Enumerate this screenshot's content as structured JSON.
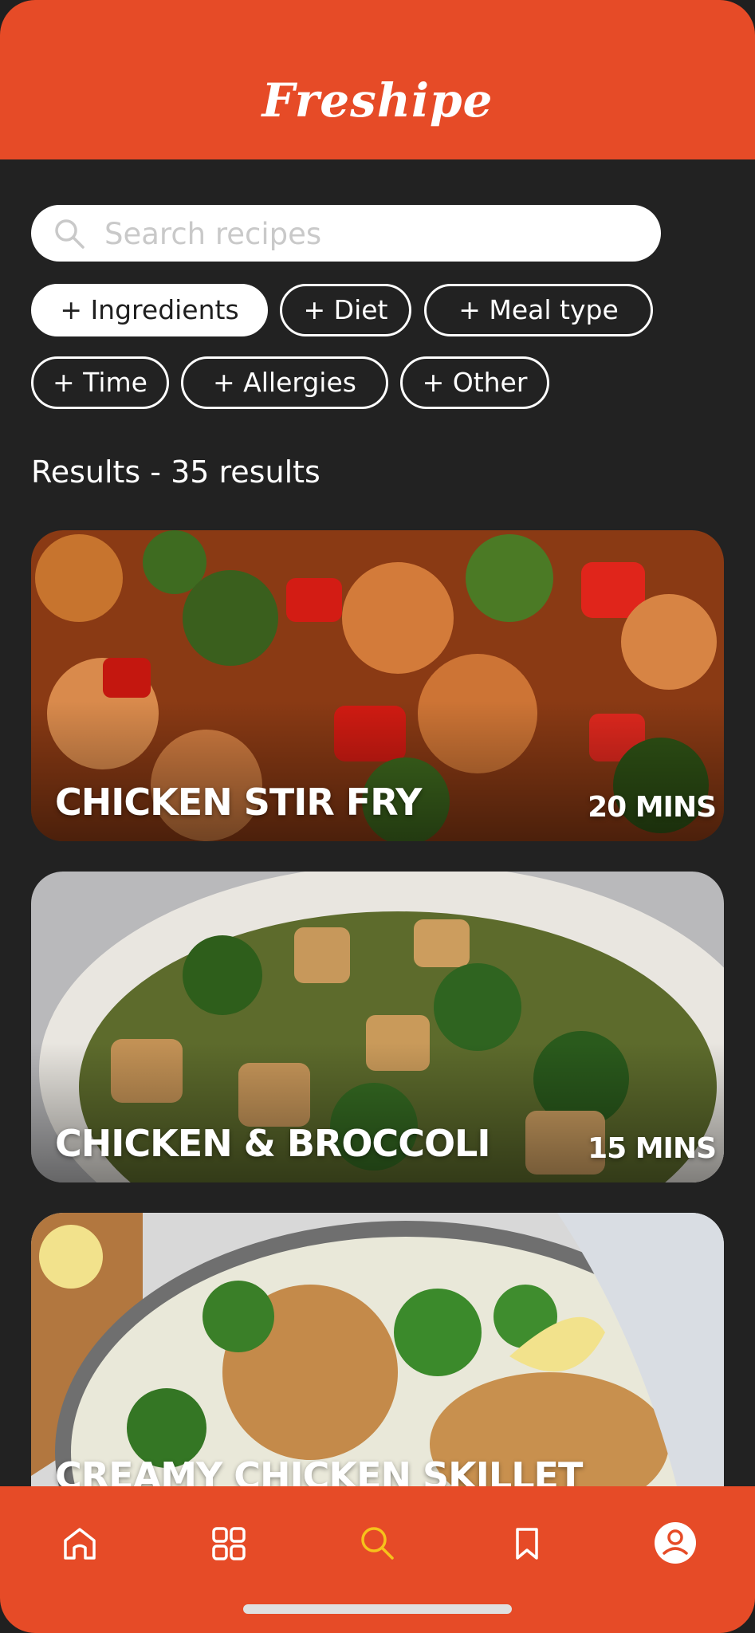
{
  "app": {
    "title": "Freshipe"
  },
  "search": {
    "placeholder": "Search recipes",
    "value": ""
  },
  "filters": [
    {
      "label": "+ Ingredients",
      "active": true
    },
    {
      "label": "+ Diet",
      "active": false
    },
    {
      "label": "+ Meal type",
      "active": false
    },
    {
      "label": "+ Time",
      "active": false
    },
    {
      "label": "+ Allergies",
      "active": false
    },
    {
      "label": "+ Other",
      "active": false
    }
  ],
  "results": {
    "heading": "Results - 35 results"
  },
  "recipes": [
    {
      "title": "CHICKEN STIR FRY",
      "time": "20 MINS"
    },
    {
      "title": "CHICKEN & BROCCOLI",
      "time": "15 MINS"
    },
    {
      "title": "CREAMY CHICKEN SKILLET",
      "time": ""
    }
  ],
  "nav": {
    "items": [
      {
        "icon": "home-icon"
      },
      {
        "icon": "grid-icon"
      },
      {
        "icon": "search-icon",
        "active": true
      },
      {
        "icon": "bookmark-icon"
      },
      {
        "icon": "profile-icon"
      }
    ]
  },
  "colors": {
    "brand": "#E64B27",
    "background": "#222222",
    "active_nav": "#F6C21B"
  }
}
